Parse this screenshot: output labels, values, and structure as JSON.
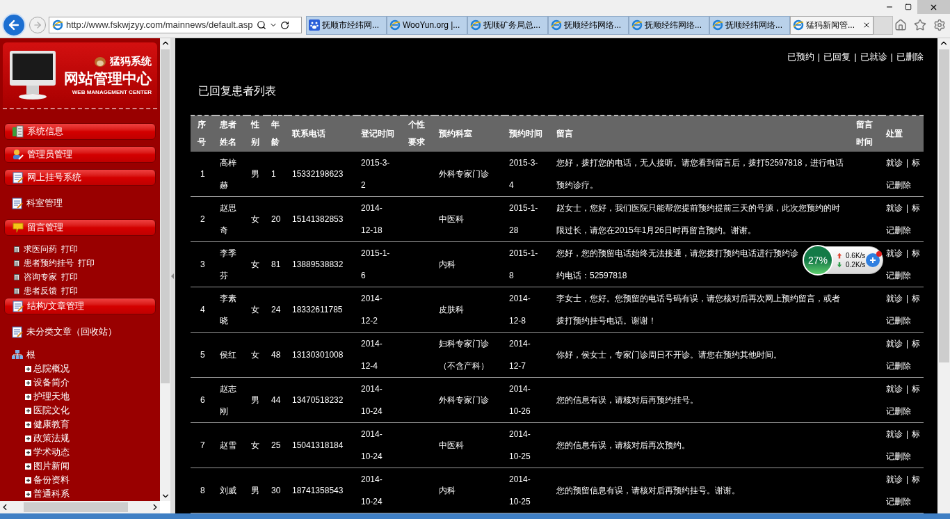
{
  "browser": {
    "address": "http://www.fskwjzyy.com/mainnews/default.asp",
    "tabs": [
      {
        "title": "抚顺市经纬网...",
        "selected": false,
        "kind": "paw"
      },
      {
        "title": "WooYun.org |...",
        "selected": false,
        "kind": "ie"
      },
      {
        "title": "抚顺矿务局总...",
        "selected": false,
        "kind": "ie"
      },
      {
        "title": "抚顺经纬网络...",
        "selected": false,
        "kind": "ie"
      },
      {
        "title": "抚顺经纬网络...",
        "selected": false,
        "kind": "ie"
      },
      {
        "title": "抚顺经纬网络...",
        "selected": false,
        "kind": "ie"
      },
      {
        "title": "猛犸新闻管...",
        "selected": true,
        "kind": "ie"
      }
    ]
  },
  "sidebar": {
    "brand": "猛犸系统",
    "title": "网站管理中心",
    "subtitle": "WEB MANAGEMENT CENTER",
    "menu": [
      {
        "kind": "header",
        "label": "系统信息"
      },
      {
        "kind": "header",
        "label": "管理员管理"
      },
      {
        "kind": "header",
        "label": "网上挂号系统"
      },
      {
        "kind": "item",
        "label": "科室管理"
      },
      {
        "kind": "header",
        "label": "留言管理"
      },
      {
        "kind": "subitem",
        "label": "求医问药",
        "link": "打印"
      },
      {
        "kind": "subitem",
        "label": "患者预约挂号",
        "link": "打印"
      },
      {
        "kind": "subitem",
        "label": "咨询专家",
        "link": "打印"
      },
      {
        "kind": "subitem",
        "label": "患者反馈",
        "link": "打印"
      },
      {
        "kind": "header",
        "label": "结构/文章管理"
      },
      {
        "kind": "item",
        "label": "未分类文章（回收站）"
      },
      {
        "kind": "tree",
        "label": "根",
        "children": [
          {
            "label": "总院概况",
            "expanded": false
          },
          {
            "label": "设备简介",
            "expanded": false
          },
          {
            "label": "护理天地",
            "expanded": false
          },
          {
            "label": "医院文化",
            "expanded": false
          },
          {
            "label": "健康教育",
            "expanded": false
          },
          {
            "label": "政策法规",
            "expanded": false
          },
          {
            "label": "学术动态",
            "expanded": false
          },
          {
            "label": "图片新闻",
            "expanded": false
          },
          {
            "label": "备份资料",
            "expanded": false
          },
          {
            "label": "普通科系",
            "expanded": false
          }
        ]
      }
    ]
  },
  "top_nav": [
    {
      "kind": "link",
      "text": "已预约"
    },
    {
      "kind": "separator",
      "text": "|"
    },
    {
      "kind": "link",
      "text": "已回复"
    },
    {
      "kind": "separator",
      "text": "|"
    },
    {
      "kind": "link",
      "text": "已就诊"
    },
    {
      "kind": "separator",
      "text": "|"
    },
    {
      "kind": "link",
      "text": "已删除"
    }
  ],
  "page_title": "已回复患者列表",
  "table": {
    "columns": [
      "序号",
      "患者姓名",
      "性别",
      "年龄",
      "联系电话",
      "登记时间",
      "个性要求",
      "预约科室",
      "预约时间",
      "留言",
      "留言时间",
      "处置"
    ],
    "rows": [
      {
        "cells": [
          "1",
          "高梓赫",
          "男",
          "1",
          "15332198623",
          "2015-3-2",
          "",
          "外科专家门诊",
          "2015-3-4",
          "您好，拨打您的电话，无人接听。请您看到留言后，拨打52597818，进行电话预约诊疗。",
          ""
        ],
        "actions": [
          {
            "kind": "link",
            "text": "就诊"
          },
          {
            "kind": "separator",
            "text": "|"
          },
          {
            "kind": "link",
            "text": "标记删除"
          }
        ]
      },
      {
        "cells": [
          "2",
          "赵思奇",
          "女",
          "20",
          "15141382853",
          "2014-12-18",
          "",
          "中医科",
          "2015-1-28",
          "赵女士，您好，我们医院只能帮您提前预约提前三天的号源，此次您预约的时限过长，请您在2015年1月26日时再留言预约。谢谢。",
          ""
        ],
        "actions": [
          {
            "kind": "link",
            "text": "就诊"
          },
          {
            "kind": "separator",
            "text": "|"
          },
          {
            "kind": "link",
            "text": "标记删除"
          }
        ]
      },
      {
        "cells": [
          "3",
          "李季芬",
          "女",
          "81",
          "13889538832",
          "2015-1-6",
          "",
          "内科",
          "2015-1-8",
          [
            "您好，您的预留电话始终无法接通，请您拨打预约电话进行预约诊",
            "约电话：52597818"
          ],
          ""
        ],
        "actions": [
          {
            "kind": "link",
            "text": "就诊"
          },
          {
            "kind": "separator",
            "text": "|"
          },
          {
            "kind": "link",
            "text": "标记删除"
          }
        ]
      },
      {
        "cells": [
          "4",
          "李素晓",
          "女",
          "24",
          "18332611785",
          "2014-12-2",
          "",
          "皮肤科",
          "2014-12-8",
          "李女士，您好。您预留的电话号码有误，请您核对后再次网上预约留言，或者拨打预约挂号电话。谢谢！",
          ""
        ],
        "actions": [
          {
            "kind": "link",
            "text": "就诊"
          },
          {
            "kind": "separator",
            "text": "|"
          },
          {
            "kind": "link",
            "text": "标记删除"
          }
        ]
      },
      {
        "cells": [
          "5",
          "侯红",
          "女",
          "48",
          "13130301008",
          "2014-12-4",
          "",
          "妇科专家门诊（不含产科）",
          "2014-12-7",
          "你好，侯女士，专家门诊周日不开诊。请您在预约其他时间。",
          ""
        ],
        "actions": [
          {
            "kind": "link",
            "text": "就诊"
          },
          {
            "kind": "separator",
            "text": "|"
          },
          {
            "kind": "link",
            "text": "标记删除"
          }
        ]
      },
      {
        "cells": [
          "6",
          "赵志刚",
          "男",
          "44",
          "13470518232",
          "2014-10-24",
          "",
          "外科专家门诊",
          "2014-10-26",
          "您的信息有误，请核对后再预约挂号。",
          ""
        ],
        "actions": [
          {
            "kind": "link",
            "text": "就诊"
          },
          {
            "kind": "separator",
            "text": "|"
          },
          {
            "kind": "link",
            "text": "标记删除"
          }
        ]
      },
      {
        "cells": [
          "7",
          "赵雪",
          "女",
          "25",
          "15041318184",
          "2014-10-24",
          "",
          "中医科",
          "2014-10-25",
          "您的信息有误，请核对后再次预约。",
          ""
        ],
        "actions": [
          {
            "kind": "link",
            "text": "就诊"
          },
          {
            "kind": "separator",
            "text": "|"
          },
          {
            "kind": "link",
            "text": "标记删除"
          }
        ]
      },
      {
        "cells": [
          "8",
          "刘威",
          "男",
          "30",
          "18741358543",
          "2014-10-24",
          "",
          "内科",
          "2014-10-25",
          "您的预留信息有误，请核对后再预约挂号。谢谢。",
          ""
        ],
        "actions": [
          {
            "kind": "link",
            "text": "就诊"
          },
          {
            "kind": "separator",
            "text": "|"
          },
          {
            "kind": "link",
            "text": "标记删除"
          }
        ]
      }
    ]
  },
  "net_widget": {
    "percent": "27%",
    "upload": "0.6K/s",
    "download": "0.2K/s"
  }
}
